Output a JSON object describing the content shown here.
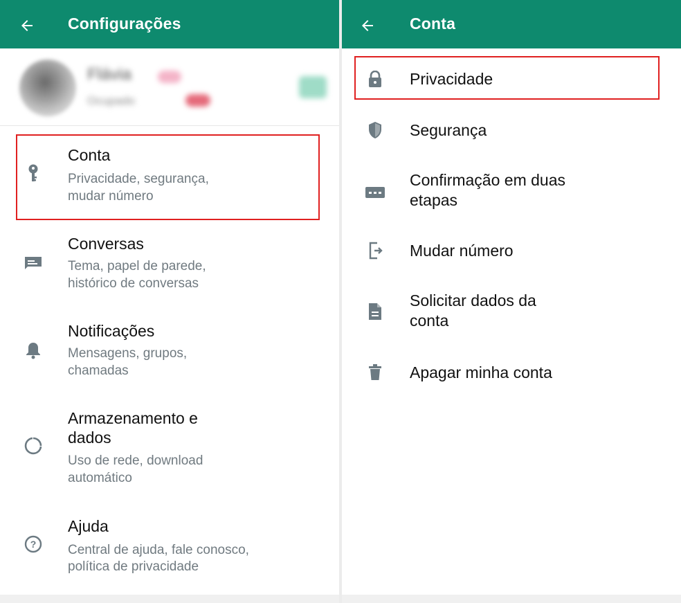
{
  "colors": {
    "header": "#0e8a6e",
    "highlight": "#e02020",
    "icon": "#6c7a82"
  },
  "left_panel": {
    "title": "Configurações",
    "back_icon": "arrow-left-icon",
    "profile": {
      "name": "Flávia",
      "status": "Ocupado"
    },
    "items": [
      {
        "title": "Conta",
        "subtitle_line1": "Privacidade, segurança,",
        "subtitle_line2": "mudar número",
        "icon": "key-icon"
      },
      {
        "title": "Conversas",
        "subtitle_line1": "Tema, papel de parede,",
        "subtitle_line2": "histórico de conversas",
        "icon": "chat-icon"
      },
      {
        "title": "Notificações",
        "subtitle_line1": "Mensagens, grupos,",
        "subtitle_line2": "chamadas",
        "icon": "bell-icon"
      },
      {
        "title_line1": "Armazenamento e",
        "title_line2": "dados",
        "subtitle_line1": "Uso de rede, download",
        "subtitle_line2": "automático",
        "icon": "data-usage-icon"
      },
      {
        "title": "Ajuda",
        "subtitle_line1": "Central de ajuda, fale conosco,",
        "subtitle_line2": "política de privacidade",
        "icon": "help-icon"
      }
    ]
  },
  "right_panel": {
    "title": "Conta",
    "back_icon": "arrow-left-icon",
    "items": [
      {
        "label": "Privacidade",
        "icon": "lock-icon"
      },
      {
        "label": "Segurança",
        "icon": "shield-icon"
      },
      {
        "label_line1": "Confirmação em duas",
        "label_line2": "etapas",
        "icon": "dots-password-icon"
      },
      {
        "label": "Mudar número",
        "icon": "change-number-icon"
      },
      {
        "label_line1": "Solicitar dados da",
        "label_line2": "conta",
        "icon": "document-icon"
      },
      {
        "label": "Apagar minha conta",
        "icon": "trash-icon"
      }
    ]
  }
}
